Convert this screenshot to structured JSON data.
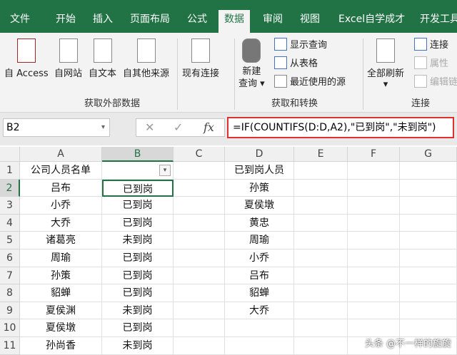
{
  "tabs": [
    "文件",
    "开始",
    "插入",
    "页面布局",
    "公式",
    "数据",
    "审阅",
    "视图",
    "Excel自学成才",
    "开发工具"
  ],
  "ribbon": {
    "from_access": "自 Access",
    "from_web": "自网站",
    "from_text": "自文本",
    "from_other": "自其他来源",
    "existing": "现有连接",
    "group1": "获取外部数据",
    "new_query_1": "新建",
    "new_query_2": "查询",
    "show_query": "显示查询",
    "from_table": "从表格",
    "recent": "最近使用的源",
    "group2": "获取和转换",
    "refresh_all": "全部刷新",
    "connections": "连接",
    "properties": "属性",
    "edit_links": "编辑链",
    "group3": "连接"
  },
  "formula_bar": {
    "name_box": "B2",
    "formula": "=IF(COUNTIFS(D:D,A2),\"已到岗\",\"未到岗\")",
    "fx": "fx"
  },
  "columns": [
    "A",
    "B",
    "C",
    "D",
    "E",
    "F",
    "G"
  ],
  "rows": [
    [
      "公司人员名单",
      "",
      "",
      "已到岗人员"
    ],
    [
      "吕布",
      "已到岗",
      "",
      "孙策"
    ],
    [
      "小乔",
      "已到岗",
      "",
      "夏侯墩"
    ],
    [
      "大乔",
      "已到岗",
      "",
      "黄忠"
    ],
    [
      "诸葛亮",
      "未到岗",
      "",
      "周瑜"
    ],
    [
      "周瑜",
      "已到岗",
      "",
      "小乔"
    ],
    [
      "孙策",
      "已到岗",
      "",
      "吕布"
    ],
    [
      "貂蝉",
      "已到岗",
      "",
      "貂蝉"
    ],
    [
      "夏侯渊",
      "未到岗",
      "",
      "大乔"
    ],
    [
      "夏侯墩",
      "已到岗",
      "",
      ""
    ],
    [
      "孙尚香",
      "未到岗",
      "",
      ""
    ]
  ],
  "watermark": "头条 @不一样的旋旋"
}
